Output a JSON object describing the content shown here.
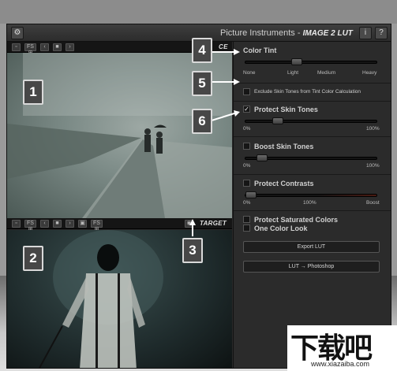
{
  "app": {
    "brand": "Picture Instruments",
    "separator": "-",
    "product": "IMAGE 2 LUT",
    "settings_icon": "gear-icon",
    "info_button": "i",
    "help_button": "?"
  },
  "source_pane": {
    "label": "SOURCE",
    "label_visible": "CE",
    "toolbar": [
      "camera-icon",
      "FS",
      "prev-icon",
      "folder-icon",
      "next-icon"
    ],
    "fs_label": "FS ⊞"
  },
  "target_pane": {
    "label": "TARGET",
    "toolbar": [
      "camera-icon",
      "FS",
      "prev-icon",
      "folder-icon",
      "next-icon",
      "save-icon",
      "FS"
    ],
    "fs_label": "FS ⊞",
    "eye_icon": "eye-icon"
  },
  "panel": {
    "color_tint": {
      "title": "Color Tint",
      "labels": [
        "None",
        "Light",
        "Medium",
        "Heavy"
      ],
      "value": "Light",
      "position": 0.28
    },
    "exclude_skin": {
      "label": "Exclude Skin Tones from Tint Color Calculation",
      "checked": false
    },
    "protect_skin": {
      "label": "Protect Skin Tones",
      "checked": true,
      "min": "0%",
      "max": "100%",
      "position": 0.25
    },
    "boost_skin": {
      "label": "Boost Skin Tones",
      "checked": false,
      "min": "0%",
      "max": "100%",
      "position": 0.12
    },
    "protect_contrasts": {
      "label": "Protect Contrasts",
      "checked": false,
      "min": "0%",
      "mid": "100%",
      "max": "Boost",
      "position": 0.05
    },
    "protect_saturated": {
      "label": "Protect Saturated Colors",
      "checked": false
    },
    "one_color_look": {
      "label": "One Color Look",
      "checked": false
    },
    "export_button": "Export LUT",
    "photoshop_button": "LUT → Photoshop"
  },
  "annotations": [
    "1",
    "2",
    "3",
    "4",
    "5",
    "6"
  ],
  "watermark": {
    "main": "下载吧",
    "url": "www.xiazaiba.com"
  }
}
